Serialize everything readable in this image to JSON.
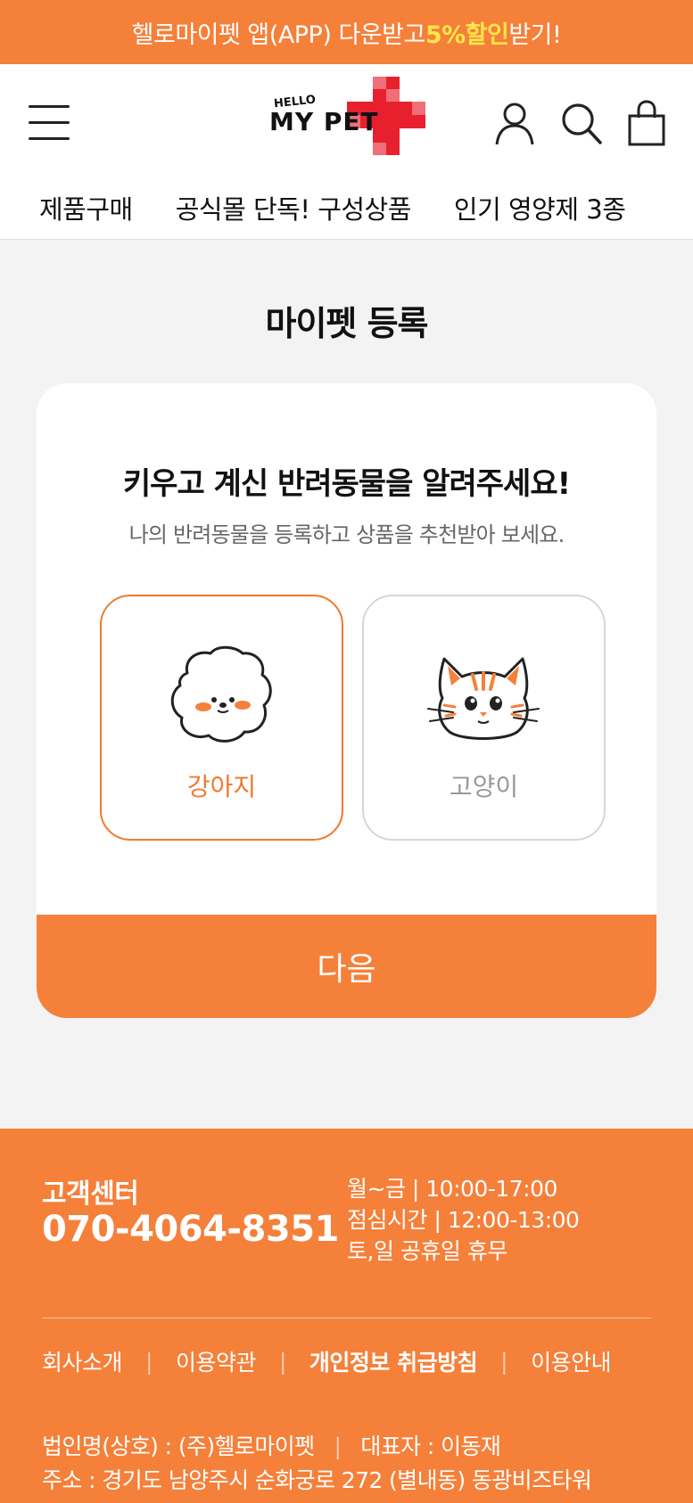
{
  "promo": {
    "text_before": "헬로마이펫 앱(APP) 다운받고",
    "highlight": "5%할인",
    "text_after": " 받기!"
  },
  "header": {
    "logo_small": "HELLO",
    "logo_main": "MY PET",
    "icons": [
      "menu-icon",
      "user-icon",
      "search-icon",
      "cart-icon"
    ]
  },
  "nav": {
    "items": [
      "제품구매",
      "공식몰 단독! 구성상품",
      "인기 영양제 3종"
    ]
  },
  "page": {
    "title": "마이펫 등록"
  },
  "card": {
    "heading": "키우고 계신 반려동물을 알려주세요!",
    "subheading": "나의 반려동물을 등록하고 상품을 추천받아 보세요.",
    "options": [
      {
        "label": "강아지",
        "selected": true
      },
      {
        "label": "고양이",
        "selected": false
      }
    ],
    "next_label": "다음"
  },
  "footer": {
    "cs_title": "고객센터",
    "cs_phone": "070-4064-8351",
    "hours": [
      "월~금  |  10:00-17:00",
      "점심시간  |  12:00-13:00",
      "토,일 공휴일 휴무"
    ],
    "links": [
      "회사소개",
      "이용약관",
      "개인정보 취급방침",
      "이용안내"
    ],
    "company": "법인명(상호) : (주)헬로마이펫",
    "ceo": "대표자 : 이동재",
    "address": "주소 : 경기도 남양주시 순화궁로 272 (별내동) 동광비즈타워"
  },
  "colors": {
    "accent": "#f5803a",
    "promo_highlight": "#ffe54a",
    "logo_red": "#e8202e",
    "background": "#f3f3f3"
  }
}
